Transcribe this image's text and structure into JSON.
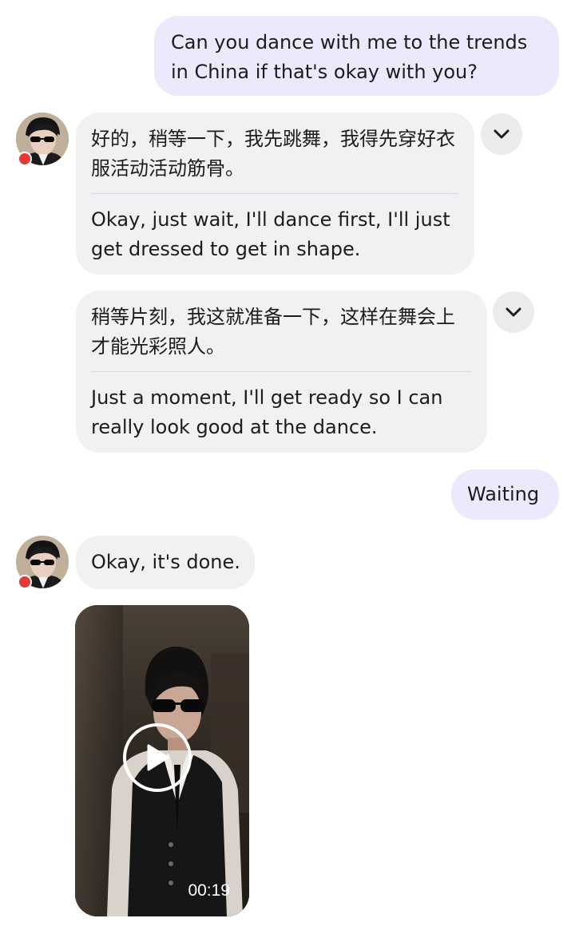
{
  "messages": [
    {
      "id": "m1",
      "sender": "user",
      "text": "Can you dance with me to the trends in China if that's okay with you?"
    },
    {
      "id": "m2",
      "sender": "contact",
      "original_text": "好的，稍等一下，我先跳舞，我得先穿好衣服活动活动筋骨。",
      "translated_text": "Okay, just wait, I'll dance first, I'll just get dressed to get in shape."
    },
    {
      "id": "m3",
      "sender": "contact",
      "original_text": "稍等片刻，我这就准备一下，这样在舞会上才能光彩照人。",
      "translated_text": "Just a moment, I'll get ready so I can really look good at the dance."
    },
    {
      "id": "m4",
      "sender": "user",
      "text": "Waiting"
    },
    {
      "id": "m5",
      "sender": "contact",
      "text": "Okay, it's done."
    },
    {
      "id": "m6",
      "sender": "contact",
      "type": "video",
      "duration": "00:19"
    }
  ],
  "icons": {
    "expand": "chevron-down-icon",
    "play": "play-icon",
    "status": "status-dot"
  },
  "colors": {
    "sent_bubble": "#ece9fc",
    "received_bubble": "#f1f1f3",
    "status_dot": "#e53935"
  }
}
